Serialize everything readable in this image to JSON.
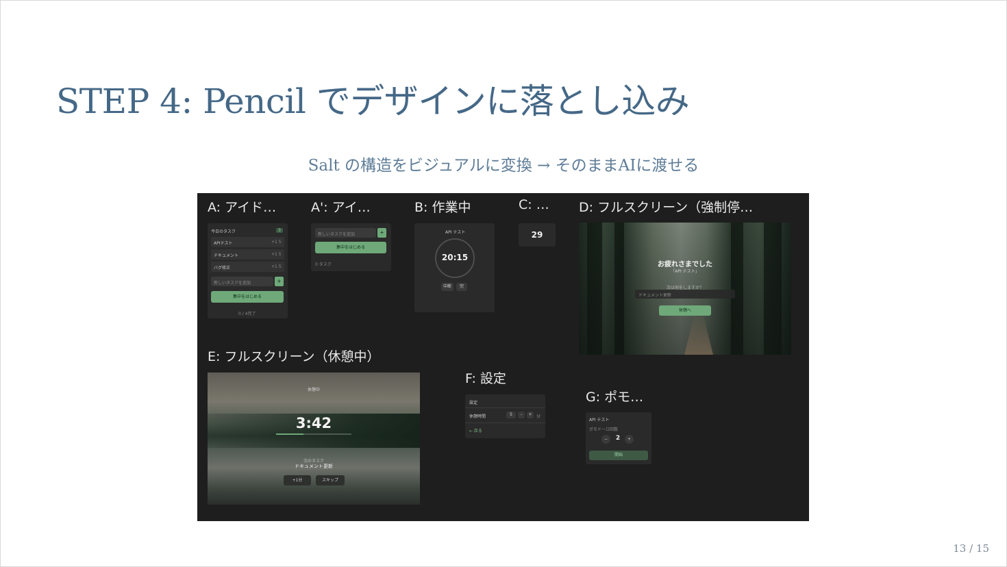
{
  "slide": {
    "title": "STEP 4: Pencil でデザインに落とし込み",
    "subtitle": "Salt の構造をビジュアルに変換 → そのままAIに渡せる",
    "page_indicator": "13 / 15"
  },
  "frames": {
    "a": {
      "label": "A: アイド…",
      "header": "今日のタスク",
      "badge": "3",
      "items": [
        {
          "name": "APIテスト",
          "meta": "+1  5"
        },
        {
          "name": "ドキュメント",
          "meta": "+1  5"
        },
        {
          "name": "バグ修正",
          "meta": "+1  5"
        }
      ],
      "input_placeholder": "新しいタスクを追加",
      "plus": "+",
      "start_button": "集中をはじめる",
      "footer": "0 / 4完了"
    },
    "a2": {
      "label": "A': アイ…",
      "input_placeholder": "新しいタスクを追加",
      "plus": "+",
      "start_button": "集中をはじめる",
      "footer": "0 タスク"
    },
    "b": {
      "label": "B: 作業中",
      "task": "API テスト",
      "time": "20:15",
      "btn1": "中断",
      "btn2": "完"
    },
    "c": {
      "label": "C: …",
      "value": "29"
    },
    "d": {
      "label": "D: フルスクリーン（強制停…",
      "heading": "お疲れさまでした",
      "task": "「API テスト」",
      "question": "次は何をしますか？",
      "input_placeholder": "ドキュメント更新",
      "button": "休憩へ"
    },
    "e": {
      "label": "E: フルスクリーン（休憩中）",
      "top_text": "休憩中",
      "time": "3:42",
      "next_label": "次のタスク",
      "next_task": "ドキュメント更新",
      "btn1": "+1分",
      "btn2": "スキップ"
    },
    "f": {
      "label": "F: 設定",
      "header": "設定",
      "row_label": "休憩時間",
      "stepper": [
        "5",
        "-",
        "+"
      ],
      "unit": "分",
      "back": "← 戻る"
    },
    "g": {
      "label": "G: ポモ…",
      "task": "API テスト",
      "sub": "ポモドーロ回数",
      "minus": "−",
      "value": "2",
      "plus": "+",
      "button": "開始"
    }
  }
}
